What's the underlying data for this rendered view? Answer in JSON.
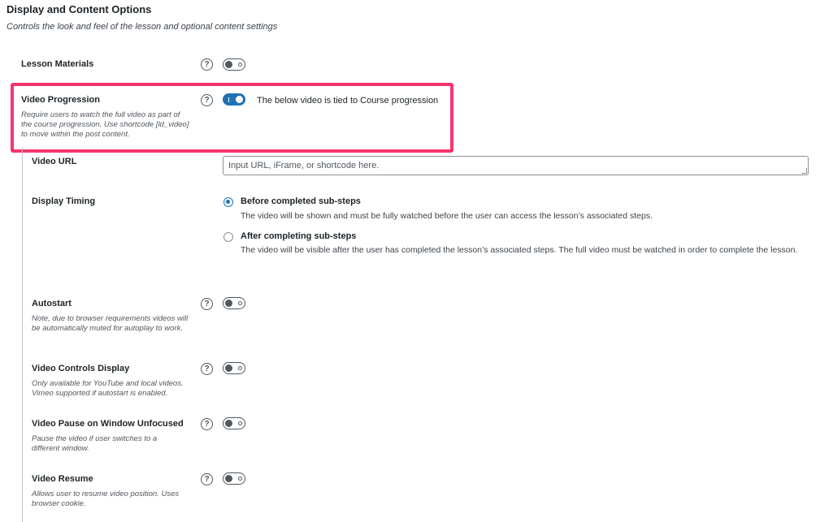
{
  "section": {
    "title": "Display and Content Options",
    "description": "Controls the look and feel of the lesson and optional content settings"
  },
  "lesson_materials": {
    "label": "Lesson Materials",
    "enabled": false
  },
  "video_progression": {
    "label": "Video Progression",
    "description": "Require users to watch the full video as part of the course progression. Use shortcode [ld_video] to move within the post content.",
    "enabled": true,
    "toggle_text": "The below video is tied to Course progression"
  },
  "video_url": {
    "label": "Video URL",
    "placeholder": "Input URL, iFrame, or shortcode here."
  },
  "display_timing": {
    "label": "Display Timing",
    "options": [
      {
        "title": "Before completed sub-steps",
        "description": "The video will be shown and must be fully watched before the user can access the lesson’s associated steps.",
        "checked": true
      },
      {
        "title": "After completing sub-steps",
        "description": "The video will be visible after the user has completed the lesson’s associated steps. The full video must be watched in order to complete the lesson.",
        "checked": false
      }
    ]
  },
  "autostart": {
    "label": "Autostart",
    "description": "Note, due to browser requirements videos will be automatically muted for autoplay to work.",
    "enabled": false
  },
  "video_controls": {
    "label": "Video Controls Display",
    "description": "Only available for YouTube and local videos. Vimeo supported if autostart is enabled.",
    "enabled": false
  },
  "video_pause": {
    "label": "Video Pause on Window Unfocused",
    "description": "Pause the video if user switches to a different window.",
    "enabled": false
  },
  "video_resume": {
    "label": "Video Resume",
    "description": "Allows user to resume video position. Uses browser cookie.",
    "enabled": false
  },
  "help_glyph": "?",
  "colors": {
    "accent": "#2271b1",
    "highlight": "#f5356e"
  }
}
